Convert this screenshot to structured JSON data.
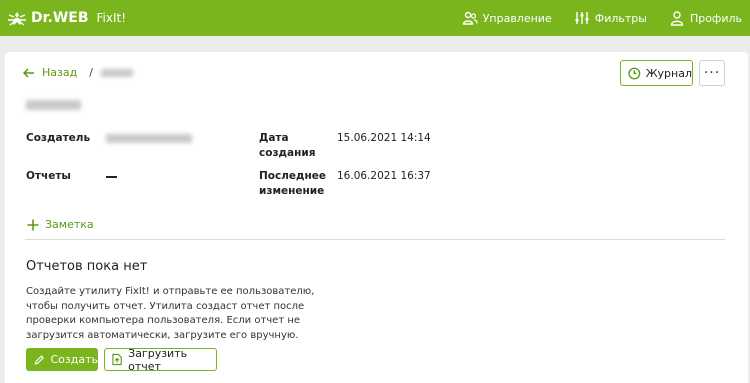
{
  "brand": {
    "name": "Dr.WEB",
    "product": "FixIt!"
  },
  "nav": [
    {
      "label": "Управление",
      "icon": "users-icon"
    },
    {
      "label": "Фильтры",
      "icon": "sliders-icon"
    },
    {
      "label": "Профиль",
      "icon": "user-icon"
    }
  ],
  "breadcrumb": {
    "back_label": "Назад",
    "separator": "/"
  },
  "toolbar": {
    "journal_label": "Журнал",
    "more_label": "···"
  },
  "fields": {
    "creator_label": "Создатель",
    "reports_label": "Отчеты",
    "created_label": "Дата создания",
    "created_value": "15.06.2021 14:14",
    "modified_label": "Последнее изменение",
    "modified_value": "16.06.2021 16:37"
  },
  "note": {
    "label": "Заметка"
  },
  "empty": {
    "title": "Отчетов пока нет",
    "text": "Создайте утилиту FixIt! и отправьте ее пользователю, чтобы получить отчет. Утилита создаст отчет после проверки компьютера пользователя. Если отчет не загрузится автоматически, загрузите его вручную."
  },
  "actions": {
    "create_label": "Создать",
    "upload_label": "Загрузить отчет"
  },
  "colors": {
    "accent": "#7ab51d",
    "link": "#5a9a12"
  }
}
